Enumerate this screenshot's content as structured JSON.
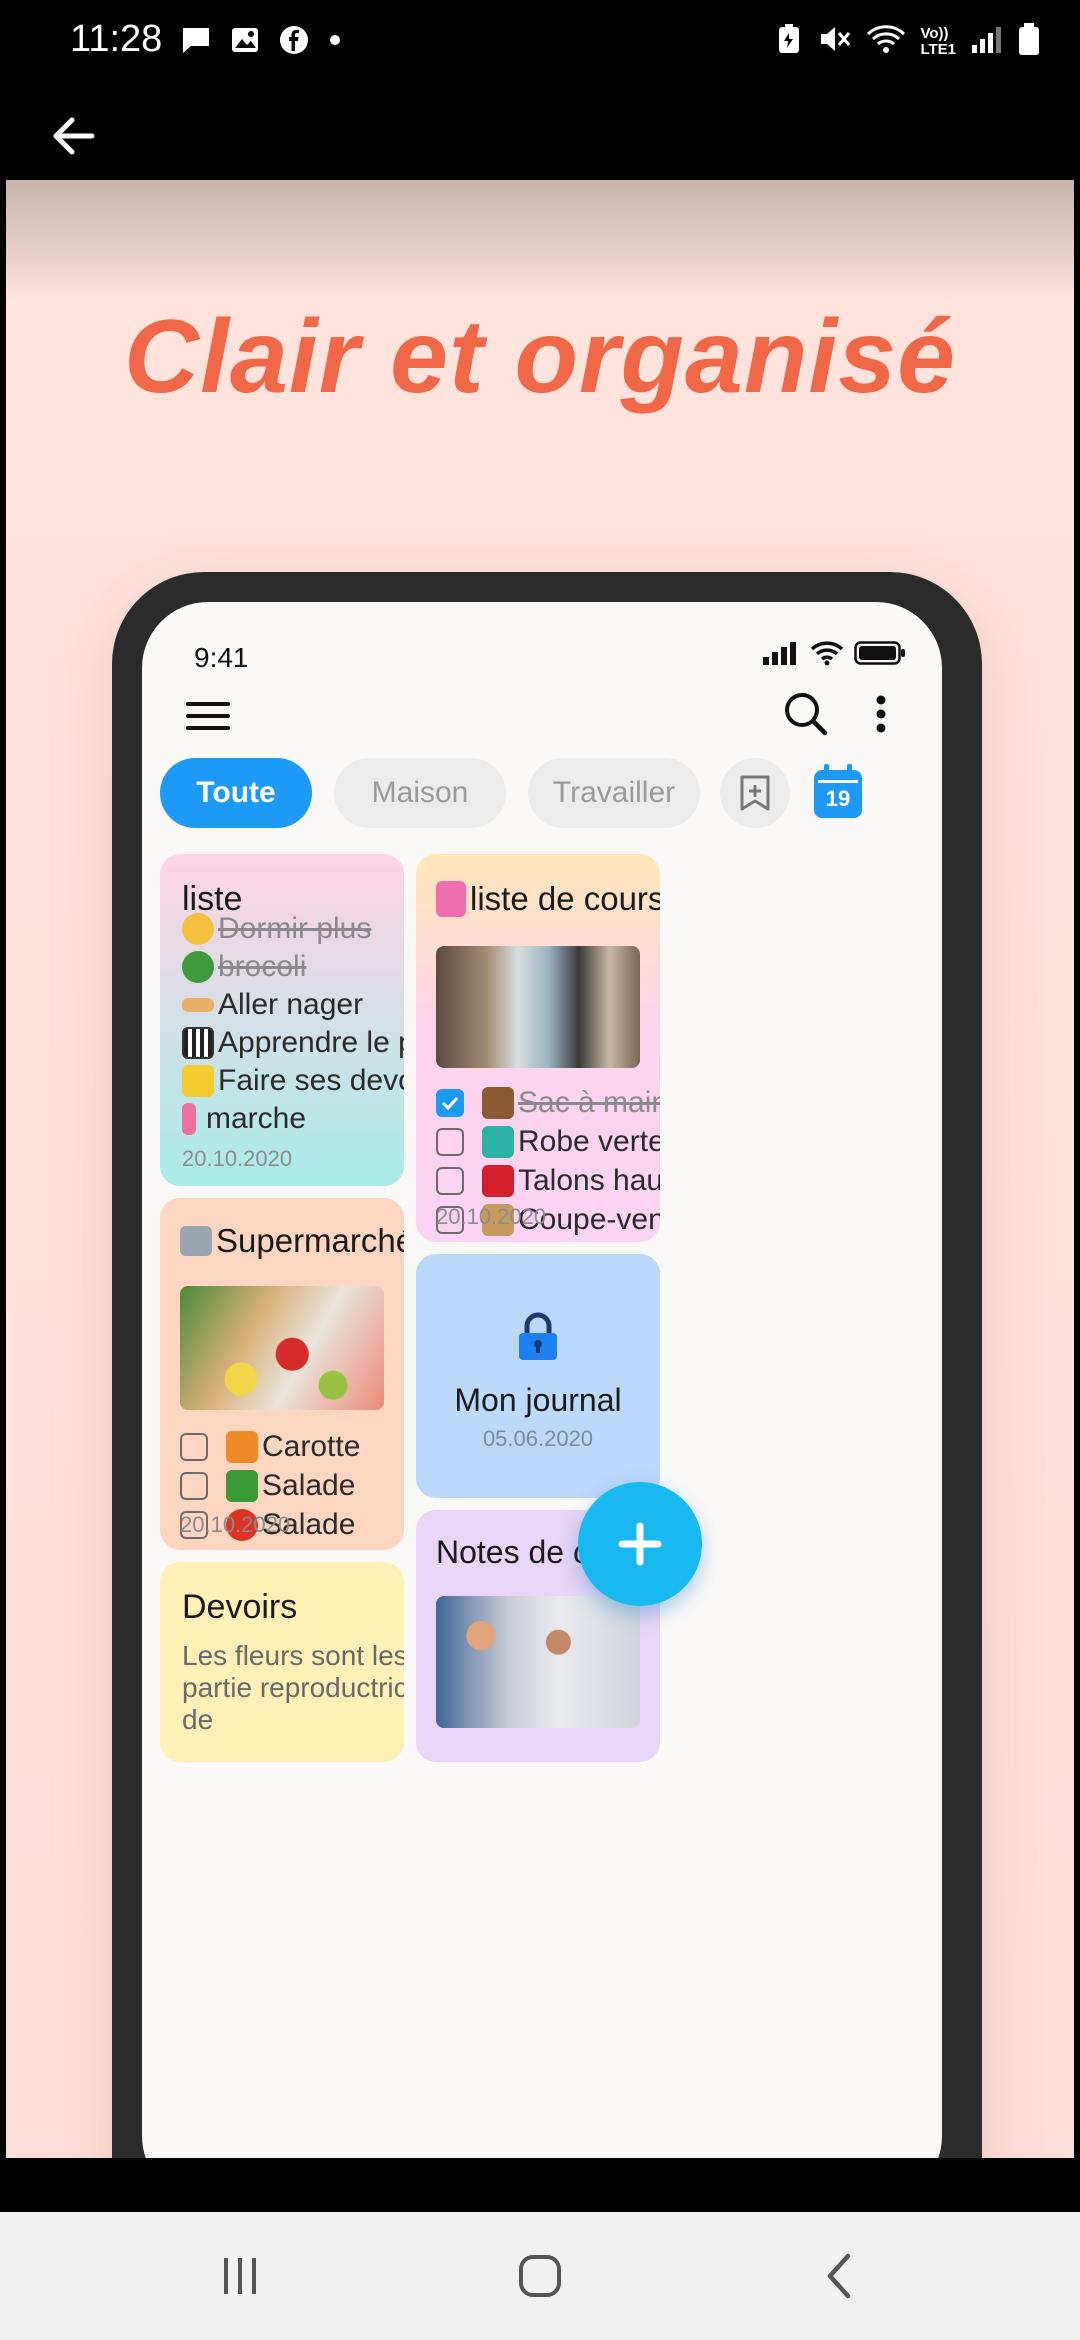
{
  "system_bar": {
    "time": "11:28",
    "network_label": "Vo))\nLTE1"
  },
  "headline": "Clair et organisé",
  "phone_screen": {
    "status_time": "9:41",
    "chips": [
      {
        "label": "Toute"
      },
      {
        "label": "Maison"
      },
      {
        "label": "Travailler"
      }
    ],
    "calendar_day": "19",
    "notes": {
      "liste": {
        "title": "liste",
        "items": [
          {
            "text": "Dormir plus",
            "done": true
          },
          {
            "text": "brocoli",
            "done": true
          },
          {
            "text": "Aller nager",
            "done": false
          },
          {
            "text": "Apprendre le piano",
            "done": false
          },
          {
            "text": "Faire ses devoirs",
            "done": false
          },
          {
            "text": "marche",
            "done": false
          }
        ],
        "date": "20.10.2020"
      },
      "courses": {
        "title": "liste de courses",
        "items": [
          {
            "text": "Sac à main",
            "checked": true
          },
          {
            "text": "Robe verte",
            "checked": false
          },
          {
            "text": "Talons hauts",
            "checked": false
          },
          {
            "text": "Coupe-vent",
            "checked": false
          }
        ],
        "date": "20.10.2020"
      },
      "supermarche": {
        "title": "Supermarché",
        "items": [
          {
            "text": "Carotte",
            "checked": false
          },
          {
            "text": "Salade",
            "checked": false
          },
          {
            "text": "Salade",
            "checked": false
          }
        ],
        "date": "20.10.2020"
      },
      "journal": {
        "title": "Mon journal",
        "date": "05.06.2020"
      },
      "devoirs": {
        "title": "Devoirs",
        "body_line1": "Les fleurs sont les",
        "body_line2": "partie reproductrice",
        "body_line3": "de"
      },
      "notes_de": {
        "title": "Notes de co"
      }
    }
  },
  "colors": {
    "accent": "#1d9af5",
    "headline": "#f06848",
    "fab": "#18b9f0"
  }
}
